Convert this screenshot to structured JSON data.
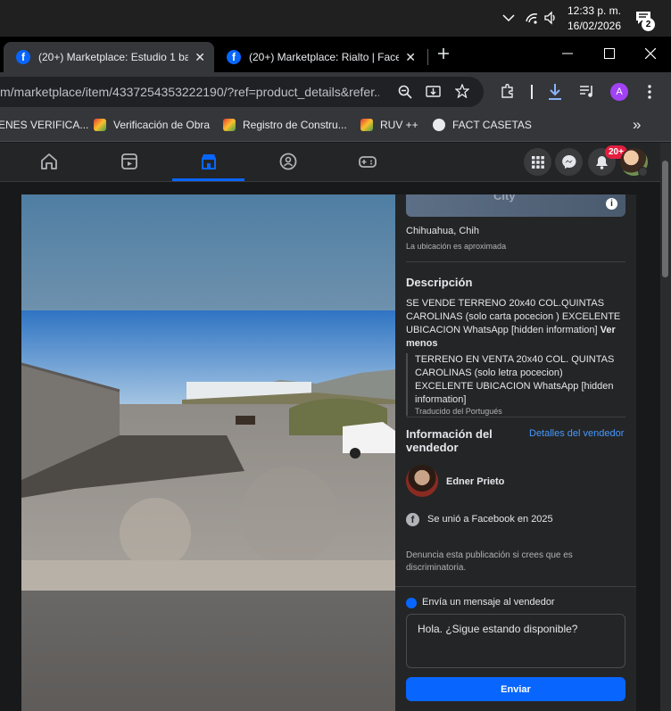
{
  "os": {
    "clock_time": "12:33 p. m.",
    "clock_date": "16/02/2026",
    "notification_count": "2"
  },
  "tabs": [
    {
      "title": "(20+) Marketplace: Estudio 1 ba",
      "active": true
    },
    {
      "title": "(20+) Marketplace: Rialto | Face",
      "active": false
    }
  ],
  "address_bar": {
    "url": "m/marketplace/item/4337254353222190/?ref=product_details&refer..."
  },
  "profile_initial": "A",
  "bookmarks": [
    {
      "label": "ENES VERIFICA..."
    },
    {
      "label": "Verificación de Obra"
    },
    {
      "label": "Registro de Constru..."
    },
    {
      "label": "RUV ++"
    },
    {
      "label": "FACT CASETAS"
    }
  ],
  "bookmarks_overflow": "»",
  "fb_header": {
    "notifications_badge": "20+"
  },
  "listing": {
    "location": "Chihuahua, Chih",
    "location_note": "La ubicación es aproximada",
    "map_label": "City",
    "description_heading": "Descripción",
    "description": "SE VENDE TERRENO 20x40 COL.QUINTAS CAROLINAS (solo carta pocecion ) EXCELENTE UBICACION  WhatsApp [hidden information]",
    "see_less": "Ver menos",
    "translation": "TERRENO EN VENTA 20x40 COL. QUINTAS CAROLINAS (solo letra pocecion) EXCELENTE UBICACION WhatsApp [hidden information]",
    "translated_from": "Traducido del Portugués",
    "seller_heading": "Información del vendedor",
    "seller_details_link": "Detalles del vendedor",
    "seller_name": "Edner Prieto",
    "joined": "Se unió a Facebook en 2025",
    "report_text": "Denuncia esta publicación si crees que es discriminatoria.",
    "message_heading": "Envía un mensaje al vendedor",
    "message_value": "Hola. ¿Sigue estando disponible?",
    "send_label": "Enviar"
  }
}
